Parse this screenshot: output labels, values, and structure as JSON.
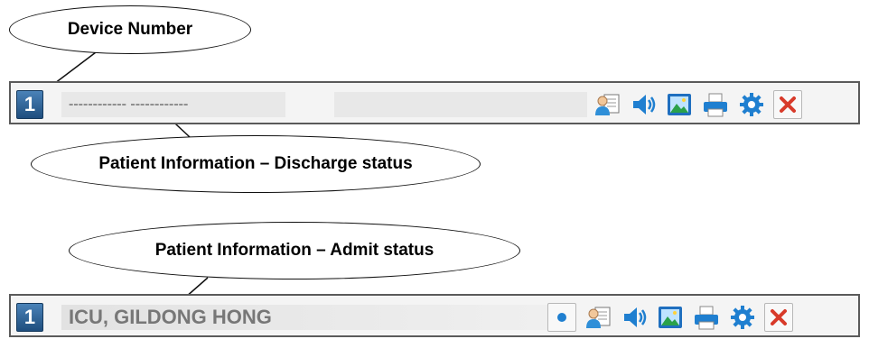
{
  "callouts": {
    "device_number": "Device Number",
    "discharge": "Patient Information – Discharge status",
    "admit": "Patient Information – Admit status"
  },
  "discharge_bar": {
    "device_number": "1",
    "patient_info": "------------ ------------",
    "icons": [
      "patient-card-icon",
      "speaker-icon",
      "image-icon",
      "printer-icon",
      "gear-icon",
      "close-icon"
    ]
  },
  "admit_bar": {
    "device_number": "1",
    "patient_info": "ICU, GILDONG HONG",
    "icons": [
      "record-icon",
      "patient-card-icon",
      "speaker-icon",
      "image-icon",
      "printer-icon",
      "gear-icon",
      "close-icon"
    ]
  },
  "colors": {
    "device_badge": "#2d5f93",
    "icon_blue": "#1f7fd0",
    "close_red": "#d83a2a",
    "bar_border": "#5a5a5a"
  }
}
